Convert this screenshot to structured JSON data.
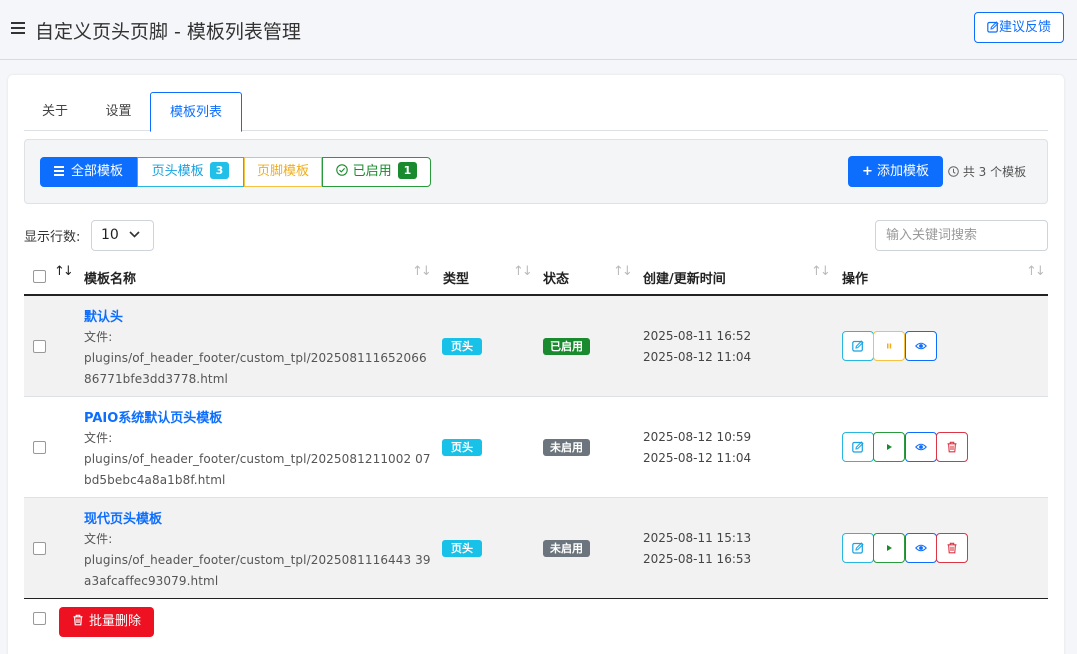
{
  "header": {
    "title": "自定义页头页脚 - 模板列表管理",
    "feedback_label": "建议反馈"
  },
  "tabs": [
    {
      "label": "关于",
      "active": false
    },
    {
      "label": "设置",
      "active": false
    },
    {
      "label": "模板列表",
      "active": true
    }
  ],
  "filters": {
    "all_label": "全部模板",
    "header_label": "页头模板",
    "header_count": "3",
    "footer_label": "页脚模板",
    "enabled_label": "已启用",
    "enabled_count": "1"
  },
  "toolbar": {
    "add_label": "添加模板",
    "total_text": "共 3 个模板"
  },
  "list_controls": {
    "rows_label": "显示行数:",
    "rows_value": "10",
    "search_placeholder": "输入关键词搜索"
  },
  "table": {
    "headers": [
      "模板名称",
      "类型",
      "状态",
      "创建/更新时间",
      "操作"
    ],
    "rows": [
      {
        "name": "默认头",
        "file_label": "文件:",
        "file_path": "plugins/of_header_footer/custom_tpl/20250811165206686771bfe3dd3778.html",
        "type": "页头",
        "status": "已启用",
        "created": "2025-08-11 16:52",
        "updated": "2025-08-12 11:04"
      },
      {
        "name": "PAIO系统默认页头模板",
        "file_label": "文件:",
        "file_path": "plugins/of_header_footer/custom_tpl/2025081211002 07bd5bebc4a8a1b8f.html",
        "type": "页头",
        "status": "未启用",
        "created": "2025-08-12 10:59",
        "updated": "2025-08-12 11:04"
      },
      {
        "name": "现代页头模板",
        "file_label": "文件:",
        "file_path": "plugins/of_header_footer/custom_tpl/2025081116443 39a3afcaffec93079.html",
        "type": "页头",
        "status": "未启用",
        "created": "2025-08-11 15:13",
        "updated": "2025-08-11 16:53"
      }
    ]
  },
  "footer": {
    "bulk_delete_label": "批量删除"
  },
  "colors": {
    "primary": "#0d6efd",
    "info": "#17c1e8",
    "warning": "#f0ad1a",
    "success": "#198a2e",
    "danger": "#ee1122",
    "secondary": "#6c757d"
  }
}
